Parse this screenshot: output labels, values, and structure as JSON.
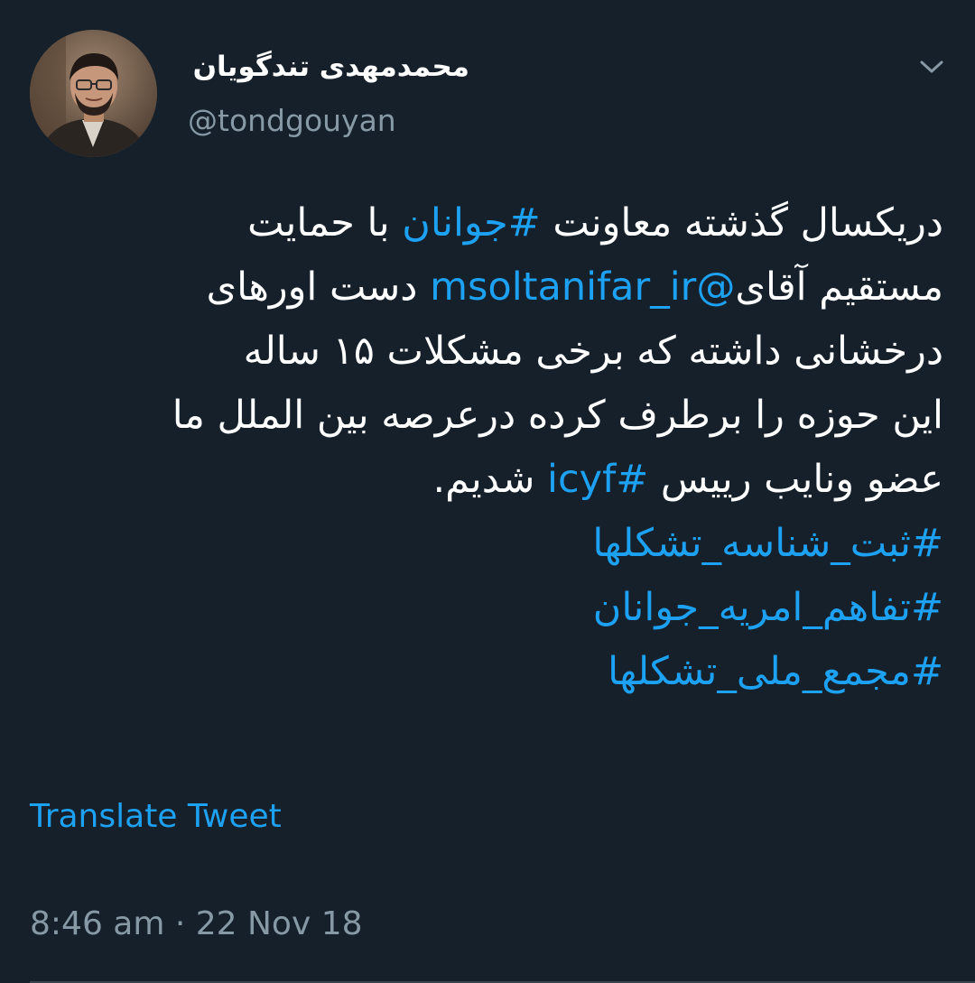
{
  "author": {
    "display_name": "محمدمهدی تندگویان",
    "handle": "@tondgouyan",
    "avatar_icon": "profile-photo"
  },
  "menu": {
    "caret_icon": "chevron-down-icon"
  },
  "tweet": {
    "line1": {
      "before": "دریکسال گذشته معاونت ",
      "hashtag": "#جوانان",
      "after": " با حمایت"
    },
    "line2": {
      "before": "مستقیم آقای",
      "mention": "@msoltanifar_ir",
      "after": " دست اورهای"
    },
    "line3": "درخشانی داشته که برخی مشکلات ۱۵ ساله",
    "line4": "این حوزه را برطرف کرده درعرصه بین الملل ما",
    "line5": {
      "before": "عضو ونایب رییس ",
      "hashtag": "#icyf",
      "after": " شدیم."
    },
    "hashtags": [
      "#ثبت_شناسه_تشکلها",
      "#تفاهم_امریه_جوانان",
      "#مجمع_ملی_تشکلها"
    ]
  },
  "translate_label": "Translate Tweet",
  "timestamp": "8:46 am · 22 Nov 18",
  "colors": {
    "background": "#15202b",
    "link": "#1da1f2",
    "secondary_text": "#8899a6"
  }
}
